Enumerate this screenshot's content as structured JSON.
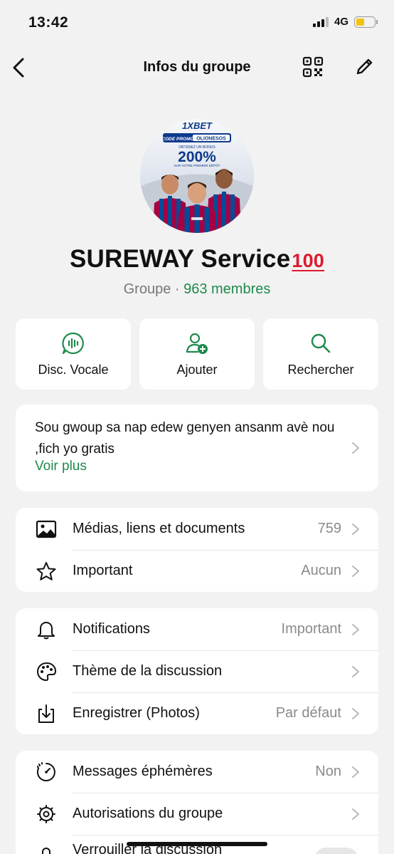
{
  "status": {
    "time": "13:42",
    "network": "4G"
  },
  "nav": {
    "title": "Infos du groupe"
  },
  "avatar": {
    "brand": "1XBET",
    "promo_label": "CODE PROMO",
    "promo_code": "OLIONESOS",
    "bonus_text": "OBTENEZ UN BONUS",
    "bonus_value": "200%",
    "bonus_sub": "SUR VOTRE PREMIER DÉPÔT"
  },
  "group": {
    "name": "SUREWAY Service",
    "emoji": "100",
    "type": "Groupe · ",
    "members": "963 membres"
  },
  "actions": [
    {
      "label": "Disc. Vocale",
      "icon": "voice-chat-icon"
    },
    {
      "label": "Ajouter",
      "icon": "add-person-icon"
    },
    {
      "label": "Rechercher",
      "icon": "search-icon"
    }
  ],
  "description": {
    "text": "Sou gwoup sa nap edew genyen ansanm avè nou ,fich yo gratis",
    "more": "Voir plus"
  },
  "section1": [
    {
      "label": "Médias, liens et documents",
      "value": "759",
      "icon": "photo-icon"
    },
    {
      "label": "Important",
      "value": "Aucun",
      "icon": "star-icon"
    }
  ],
  "section2": [
    {
      "label": "Notifications",
      "value": "Important",
      "icon": "bell-icon"
    },
    {
      "label": "Thème de la discussion",
      "value": "",
      "icon": "palette-icon"
    },
    {
      "label": "Enregistrer (Photos)",
      "value": "Par défaut",
      "icon": "download-icon"
    }
  ],
  "section3": [
    {
      "label": "Messages éphémères",
      "value": "Non",
      "icon": "timer-icon"
    },
    {
      "label": "Autorisations du groupe",
      "value": "",
      "icon": "settings-gear-icon"
    },
    {
      "label": "Verrouiller la discussion",
      "value": "",
      "icon": "lock-icon"
    }
  ],
  "colors": {
    "accent": "#1f8a4c",
    "background": "#f2f2f2",
    "card": "#ffffff",
    "battery": "#f4c20d"
  }
}
